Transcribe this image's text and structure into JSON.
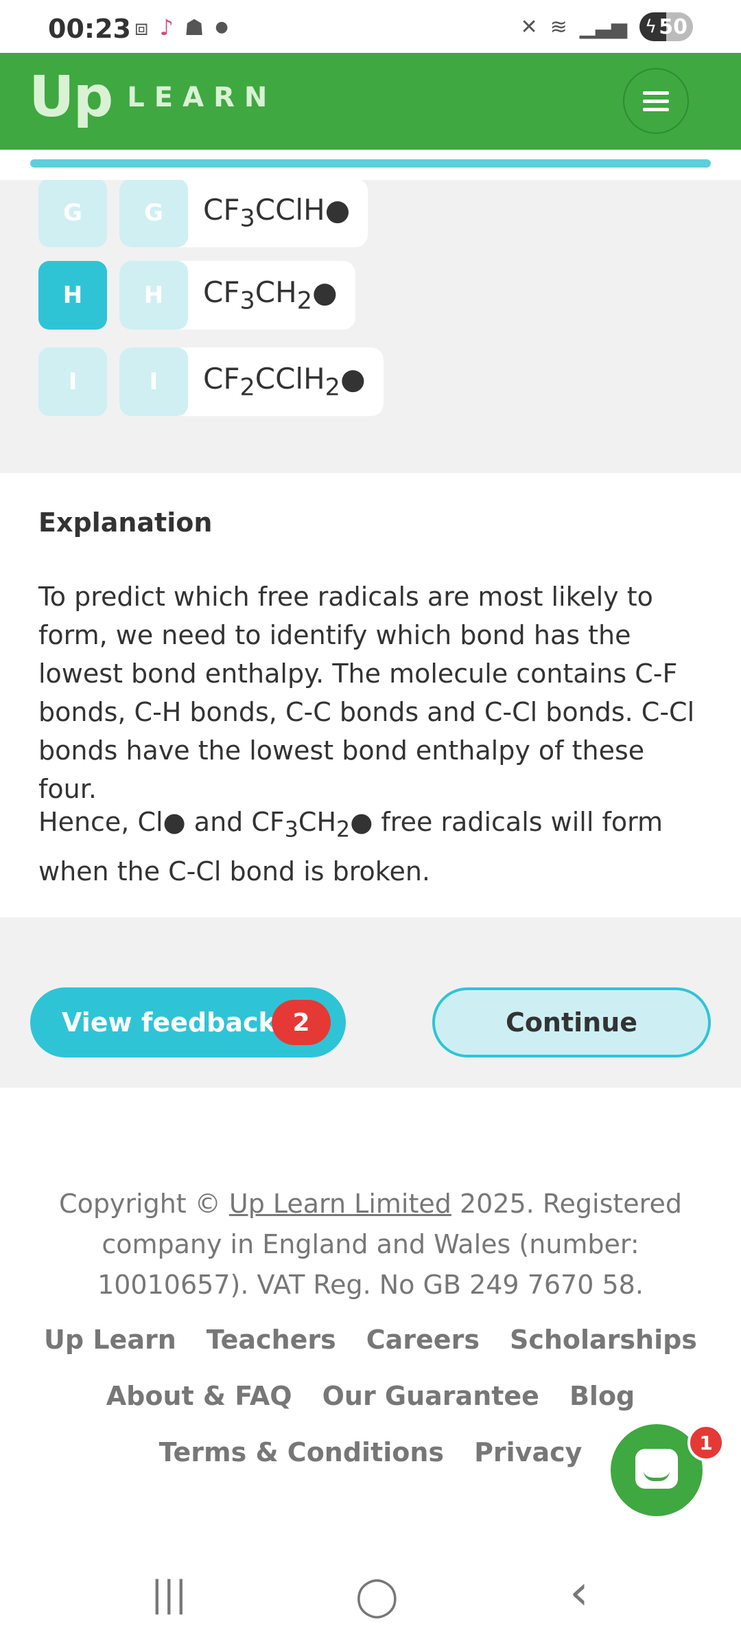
{
  "status_bar": {
    "time": "00:23",
    "battery": "50",
    "battery_level": 0.5
  },
  "header": {
    "logo_up": "Up",
    "logo_learn": "LEARN"
  },
  "progress": {
    "value": 1.0
  },
  "answers": [
    {
      "letter": "G",
      "tag": "G",
      "formula_parts": [
        "CF",
        "3",
        "CClH●"
      ],
      "selected": false
    },
    {
      "letter": "H",
      "tag": "H",
      "formula_parts": [
        "CF",
        "3",
        "CH",
        "2",
        "●"
      ],
      "selected": true
    },
    {
      "letter": "I",
      "tag": "I",
      "formula_parts": [
        "CF",
        "2",
        "CClH",
        "2",
        "●"
      ],
      "selected": false
    }
  ],
  "explanation": {
    "title": "Explanation",
    "p1": "To predict which free radicals are most likely to form, we need to identify which bond has the lowest bond enthalpy. The molecule contains C-F bonds, C-H bonds, C-C bonds and C-Cl bonds. C-Cl bonds have the lowest bond enthalpy of these four.",
    "p2_a": "Hence, Cl● and CF",
    "p2_sub1": "3",
    "p2_b": "CH",
    "p2_sub2": "2",
    "p2_c": "● free radicals will form when the C-Cl bond is broken."
  },
  "actions": {
    "feedback_label": "View feedback",
    "feedback_count": "2",
    "continue_label": "Continue"
  },
  "footer": {
    "copyright_pre": "Copyright © ",
    "copyright_link": "Up Learn Limited",
    "copyright_post": " 2025. Registered company in England and Wales (number: 10010657). VAT Reg. No GB 249 7670 58.",
    "links_row1": [
      "Up Learn",
      "Teachers",
      "Careers",
      "Scholarships"
    ],
    "links_row2": [
      "About & FAQ",
      "Our Guarantee",
      "Blog"
    ],
    "links_row3": [
      "Terms & Conditions",
      "Privacy"
    ]
  },
  "chat": {
    "badge": "1"
  },
  "nav": {
    "recents": "|||",
    "home": "◯",
    "back": "‹"
  }
}
